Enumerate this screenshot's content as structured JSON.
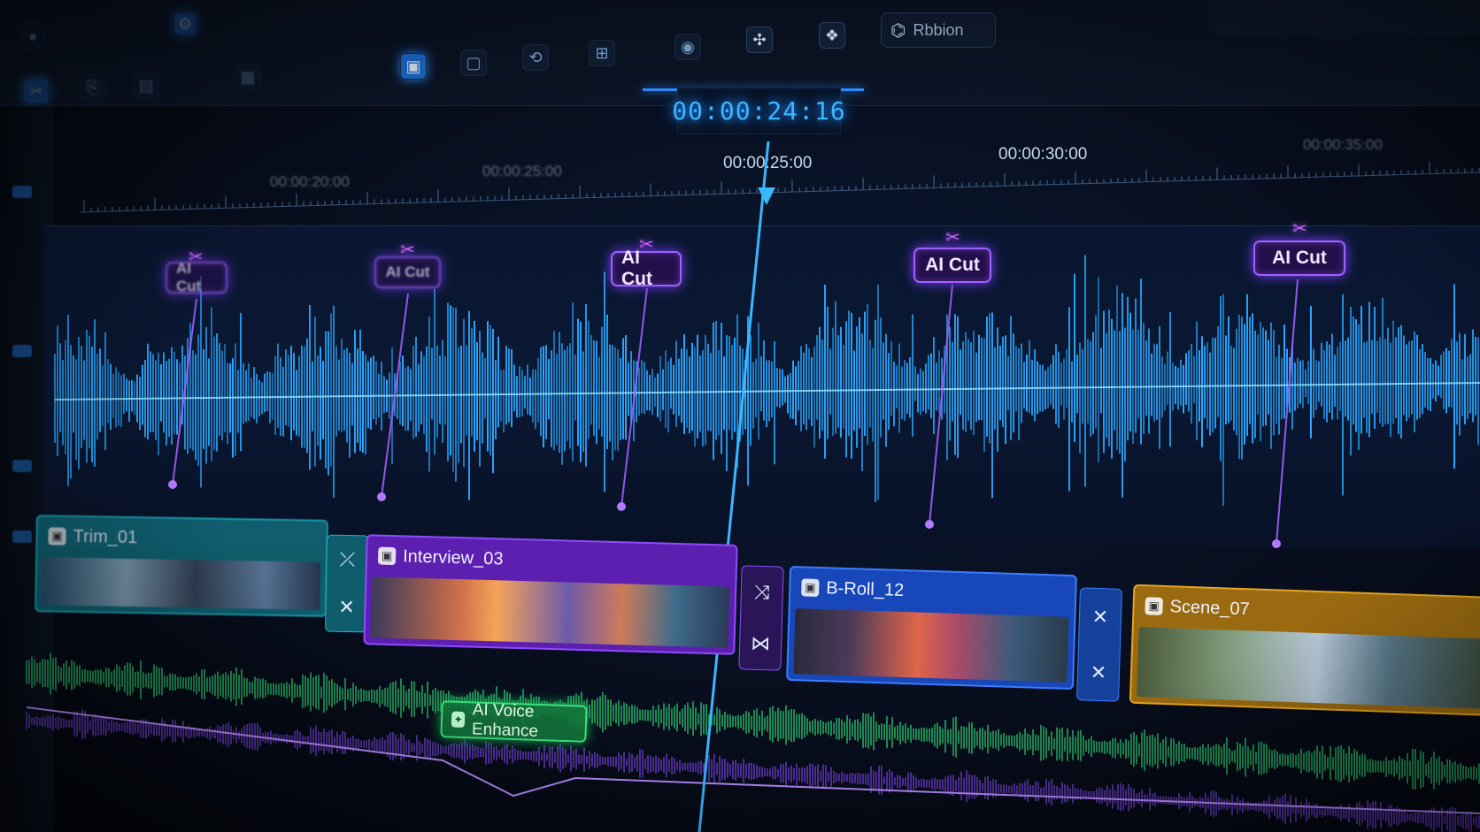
{
  "toolbar": {
    "buttons": [
      {
        "icon": "record-icon"
      },
      {
        "icon": "settings-icon"
      },
      {
        "icon": "cut-icon"
      },
      {
        "icon": "split-icon"
      },
      {
        "icon": "layers-icon"
      },
      {
        "icon": "media-icon"
      },
      {
        "icon": "grid-icon"
      },
      {
        "icon": "grid-icon"
      },
      {
        "icon": "loop-icon"
      },
      {
        "icon": "play-icon"
      },
      {
        "icon": "magic-cut-icon"
      },
      {
        "icon": "effects-icon"
      }
    ],
    "ribbon_label": "Rbbion"
  },
  "playhead": {
    "timecode": "00:00:24:16"
  },
  "ruler": {
    "labels": [
      "00:00:20:00",
      "00:00:25:00",
      "00:00:25:00",
      "00:00:30:00",
      "00:00:35:00"
    ]
  },
  "ai_markers": [
    {
      "label": "AI Cut"
    },
    {
      "label": "AI Cut"
    },
    {
      "label": "AI Cut"
    },
    {
      "label": "AI Cut"
    },
    {
      "label": "AI Cut"
    }
  ],
  "clips": [
    {
      "name": "Trim_01",
      "color": "#17a3b8"
    },
    {
      "name": "Interview_03",
      "color": "#7b2fd8"
    },
    {
      "name": "B-Roll_12",
      "color": "#1f5fe0"
    },
    {
      "name": "Scene_07",
      "color": "#d99a1a"
    }
  ],
  "audio": {
    "enhance_label": "AI Voice Enhance",
    "track_colors": {
      "voice": "#2fdc7a",
      "music": "#8a4dff"
    }
  },
  "colors": {
    "accent": "#2f8cff",
    "ai_marker": "#a060ff",
    "waveform": "#2aa8ff"
  }
}
